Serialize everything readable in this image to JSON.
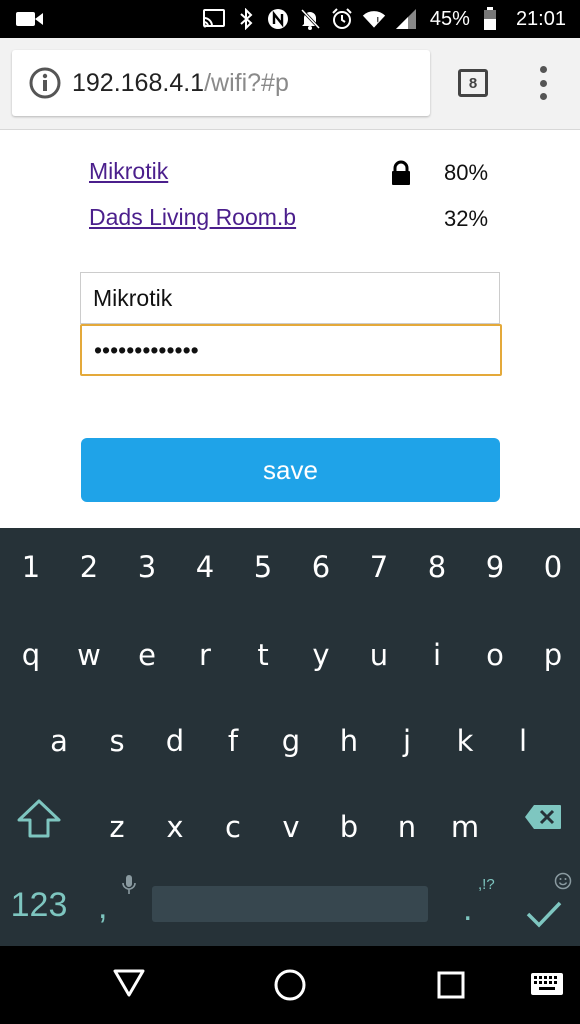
{
  "status_bar": {
    "battery_percent": "45%",
    "time": "21:01",
    "icons": [
      "video-camera-icon",
      "cast-icon",
      "bluetooth-icon",
      "nfc-icon",
      "notifications-off-icon",
      "alarm-icon",
      "wifi-icon",
      "cell-signal-icon",
      "battery-icon"
    ]
  },
  "browser": {
    "url_host": "192.168.4.1",
    "url_path": "/wifi?#p",
    "tab_count": "8"
  },
  "networks": [
    {
      "ssid": "Mikrotik",
      "locked": true,
      "signal": "80%"
    },
    {
      "ssid": "Dads Living Room.b",
      "locked": false,
      "signal": "32%"
    }
  ],
  "form": {
    "ssid_value": "Mikrotik",
    "password_value": "•••••••••••••",
    "save_label": "save"
  },
  "keyboard": {
    "row_numbers": [
      "1",
      "2",
      "3",
      "4",
      "5",
      "6",
      "7",
      "8",
      "9",
      "0"
    ],
    "row_top": [
      "q",
      "w",
      "e",
      "r",
      "t",
      "y",
      "u",
      "i",
      "o",
      "p"
    ],
    "row_middle": [
      "a",
      "s",
      "d",
      "f",
      "g",
      "h",
      "j",
      "k",
      "l"
    ],
    "row_bottom": [
      "z",
      "x",
      "c",
      "v",
      "b",
      "n",
      "m"
    ],
    "symbols_label": "123",
    "comma_label": ",",
    "punct_hint": ",!?",
    "period_label": ".",
    "accent_color": "#7ec6c0"
  },
  "colors": {
    "save_button": "#1fa3e8",
    "focus_border": "#e4a93a",
    "link": "#4b1f8c",
    "keyboard_bg": "#263238"
  }
}
